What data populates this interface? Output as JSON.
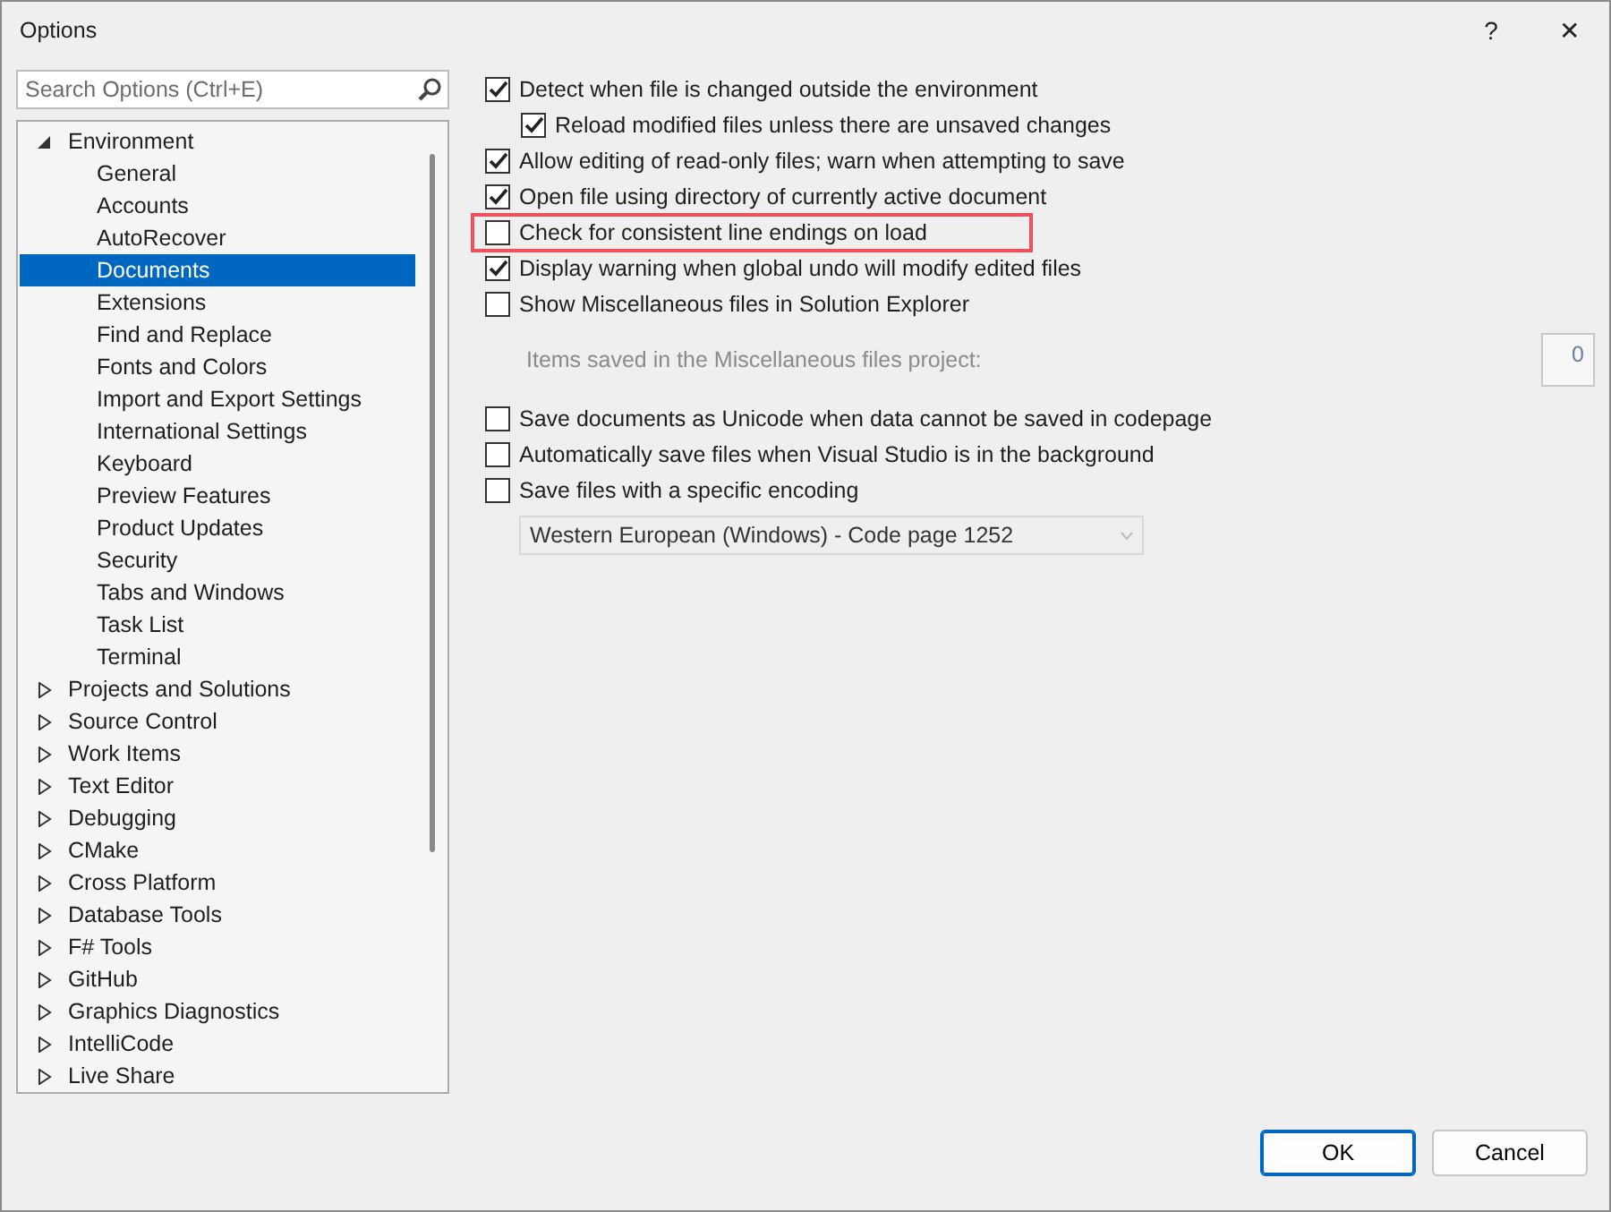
{
  "window": {
    "title": "Options",
    "help": "?",
    "close": "✕"
  },
  "search": {
    "placeholder": "Search Options (Ctrl+E)"
  },
  "tree": [
    {
      "label": "Environment",
      "expanded": true,
      "selected": false,
      "children": [
        {
          "label": "General",
          "selected": false
        },
        {
          "label": "Accounts",
          "selected": false
        },
        {
          "label": "AutoRecover",
          "selected": false
        },
        {
          "label": "Documents",
          "selected": true
        },
        {
          "label": "Extensions",
          "selected": false
        },
        {
          "label": "Find and Replace",
          "selected": false
        },
        {
          "label": "Fonts and Colors",
          "selected": false
        },
        {
          "label": "Import and Export Settings",
          "selected": false
        },
        {
          "label": "International Settings",
          "selected": false
        },
        {
          "label": "Keyboard",
          "selected": false
        },
        {
          "label": "Preview Features",
          "selected": false
        },
        {
          "label": "Product Updates",
          "selected": false
        },
        {
          "label": "Security",
          "selected": false
        },
        {
          "label": "Tabs and Windows",
          "selected": false
        },
        {
          "label": "Task List",
          "selected": false
        },
        {
          "label": "Terminal",
          "selected": false
        }
      ]
    },
    {
      "label": "Projects and Solutions",
      "expanded": false,
      "selected": false
    },
    {
      "label": "Source Control",
      "expanded": false,
      "selected": false
    },
    {
      "label": "Work Items",
      "expanded": false,
      "selected": false
    },
    {
      "label": "Text Editor",
      "expanded": false,
      "selected": false
    },
    {
      "label": "Debugging",
      "expanded": false,
      "selected": false
    },
    {
      "label": "CMake",
      "expanded": false,
      "selected": false
    },
    {
      "label": "Cross Platform",
      "expanded": false,
      "selected": false
    },
    {
      "label": "Database Tools",
      "expanded": false,
      "selected": false
    },
    {
      "label": "F# Tools",
      "expanded": false,
      "selected": false
    },
    {
      "label": "GitHub",
      "expanded": false,
      "selected": false
    },
    {
      "label": "Graphics Diagnostics",
      "expanded": false,
      "selected": false
    },
    {
      "label": "IntelliCode",
      "expanded": false,
      "selected": false
    },
    {
      "label": "Live Share",
      "expanded": false,
      "selected": false
    }
  ],
  "options": [
    {
      "kind": "checkbox",
      "label": "Detect when file is changed outside the environment",
      "checked": true,
      "highlighted": false
    },
    {
      "kind": "subcheckbox",
      "label": "Reload modified files unless there are unsaved changes",
      "checked": true,
      "highlighted": false
    },
    {
      "kind": "checkbox",
      "label": "Allow editing of read-only files; warn when attempting to save",
      "checked": true,
      "highlighted": false
    },
    {
      "kind": "checkbox",
      "label": "Open file using directory of currently active document",
      "checked": true,
      "highlighted": false
    },
    {
      "kind": "checkbox",
      "label": "Check for consistent line endings on load",
      "checked": false,
      "highlighted": true
    },
    {
      "kind": "checkbox",
      "label": "Display warning when global undo will modify edited files",
      "checked": true,
      "highlighted": false
    },
    {
      "kind": "checkbox",
      "label": "Show Miscellaneous files in Solution Explorer",
      "checked": false,
      "highlighted": false
    },
    {
      "kind": "spin",
      "label": "Items saved in the Miscellaneous files project:",
      "value": "0",
      "disabled": true
    },
    {
      "kind": "checkbox",
      "label": "Save documents as Unicode when data cannot be saved in codepage",
      "checked": false,
      "highlighted": false
    },
    {
      "kind": "checkbox",
      "label": "Automatically save files when Visual Studio is in the background",
      "checked": false,
      "highlighted": false
    },
    {
      "kind": "checkbox",
      "label": "Save files with a specific encoding",
      "checked": false,
      "highlighted": false
    },
    {
      "kind": "dropdown",
      "value": "Western European (Windows) - Code page 1252",
      "disabled": true
    }
  ],
  "buttons": [
    {
      "label": "OK",
      "default": true
    },
    {
      "label": "Cancel",
      "default": false
    }
  ]
}
